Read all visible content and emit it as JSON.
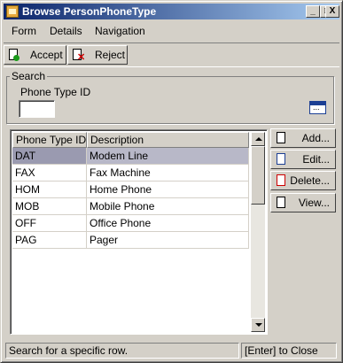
{
  "window": {
    "title": "Browse PersonPhoneType",
    "controls": {
      "minimize": "_",
      "maximize": "□",
      "close": "X"
    }
  },
  "menu": {
    "items": [
      {
        "label": "Form"
      },
      {
        "label": "Details"
      },
      {
        "label": "Navigation"
      }
    ]
  },
  "toolbar": {
    "accept_label": "Accept",
    "reject_label": "Reject"
  },
  "search": {
    "group_label": "Search",
    "field_label": "Phone Type ID",
    "value": ""
  },
  "grid": {
    "columns": [
      "Phone Type ID",
      "Description"
    ],
    "rows": [
      {
        "id": "DAT",
        "description": "Modem Line",
        "selected": true
      },
      {
        "id": "FAX",
        "description": "Fax Machine"
      },
      {
        "id": "HOM",
        "description": "Home Phone"
      },
      {
        "id": "MOB",
        "description": "Mobile Phone"
      },
      {
        "id": "OFF",
        "description": "Office Phone"
      },
      {
        "id": "PAG",
        "description": "Pager"
      }
    ]
  },
  "actions": {
    "add": "Add...",
    "edit": "Edit...",
    "delete": "Delete...",
    "view": "View..."
  },
  "status": {
    "message": "Search for a specific row.",
    "hint": "[Enter] to Close"
  },
  "colors": {
    "titlebar_start": "#0a246a",
    "titlebar_end": "#a6caf0",
    "selection": "#b8b8c8"
  }
}
